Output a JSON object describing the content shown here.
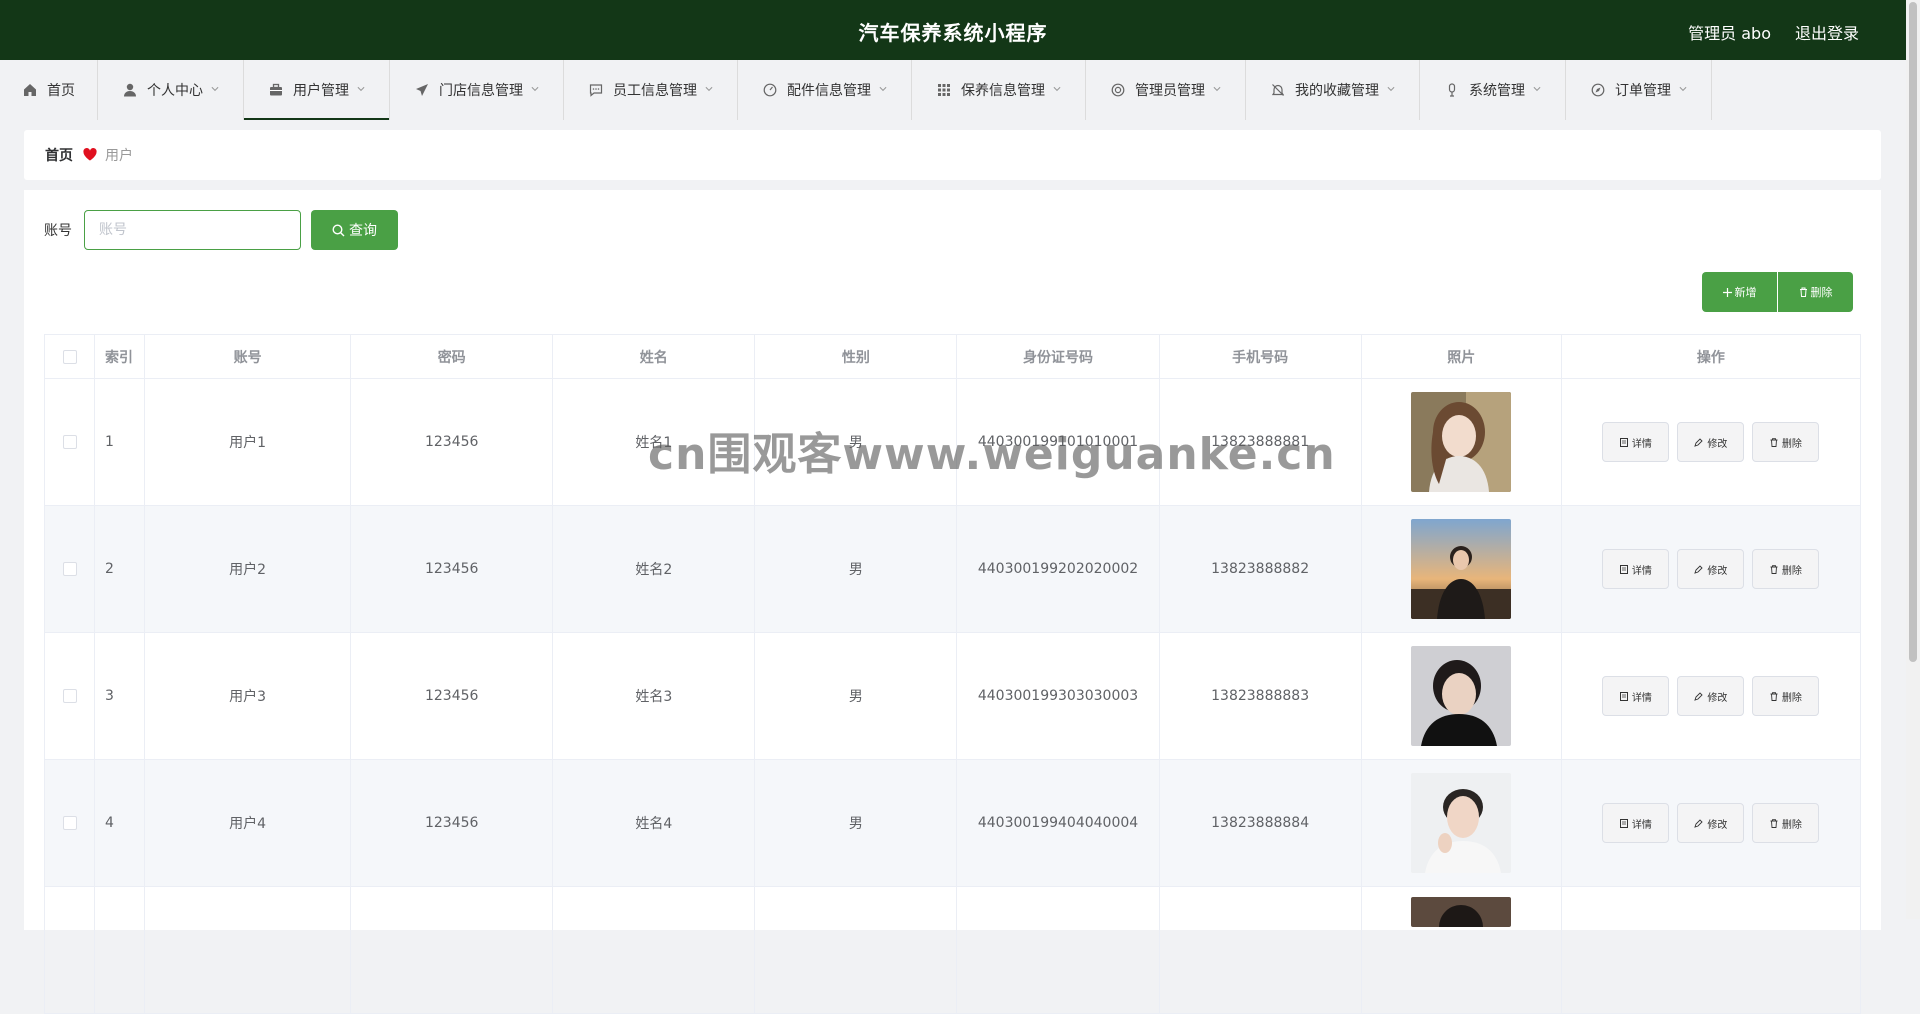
{
  "header": {
    "title": "汽车保养系统小程序",
    "admin": "管理员 abo",
    "logout": "退出登录"
  },
  "nav": [
    {
      "label": "首页",
      "icon": "home-icon",
      "chevron": false
    },
    {
      "label": "个人中心",
      "icon": "user-icon",
      "chevron": true
    },
    {
      "label": "用户管理",
      "icon": "briefcase-icon",
      "chevron": true,
      "active": true
    },
    {
      "label": "门店信息管理",
      "icon": "send-icon",
      "chevron": true
    },
    {
      "label": "员工信息管理",
      "icon": "chat-icon",
      "chevron": true
    },
    {
      "label": "配件信息管理",
      "icon": "gauge-icon",
      "chevron": true
    },
    {
      "label": "保养信息管理",
      "icon": "grid-icon",
      "chevron": true
    },
    {
      "label": "管理员管理",
      "icon": "lifebuoy-icon",
      "chevron": true
    },
    {
      "label": "我的收藏管理",
      "icon": "bell-off-icon",
      "chevron": true
    },
    {
      "label": "系统管理",
      "icon": "microphone-icon",
      "chevron": true
    },
    {
      "label": "订单管理",
      "icon": "compass-icon",
      "chevron": true
    }
  ],
  "breadcrumb": {
    "home": "首页",
    "current": "用户"
  },
  "search": {
    "label": "账号",
    "placeholder": "账号",
    "button": "查询"
  },
  "actions": {
    "add": "新增",
    "delete": "删除"
  },
  "table": {
    "headers": [
      "索引",
      "账号",
      "密码",
      "姓名",
      "性别",
      "身份证号码",
      "手机号码",
      "照片",
      "操作"
    ],
    "rows": [
      {
        "index": "1",
        "account": "用户1",
        "password": "123456",
        "name": "姓名1",
        "gender": "男",
        "id_number": "440300199101010001",
        "phone": "13823888881",
        "photo": "woman-portrait"
      },
      {
        "index": "2",
        "account": "用户2",
        "password": "123456",
        "name": "姓名2",
        "gender": "男",
        "id_number": "440300199202020002",
        "phone": "13823888882",
        "photo": "man-sunset-portrait"
      },
      {
        "index": "3",
        "account": "用户3",
        "password": "123456",
        "name": "姓名3",
        "gender": "男",
        "id_number": "440300199303030003",
        "phone": "13823888883",
        "photo": "man-dark-portrait"
      },
      {
        "index": "4",
        "account": "用户4",
        "password": "123456",
        "name": "姓名4",
        "gender": "男",
        "id_number": "440300199404040004",
        "phone": "13823888884",
        "photo": "man-light-portrait"
      }
    ],
    "op_labels": {
      "detail": "详情",
      "edit": "修改",
      "delete": "删除"
    }
  },
  "watermark": "cn围观客www.weiguanke.cn",
  "colors": {
    "header_bg": "#133717",
    "primary": "#4aa045",
    "heart": "#e0101f"
  }
}
